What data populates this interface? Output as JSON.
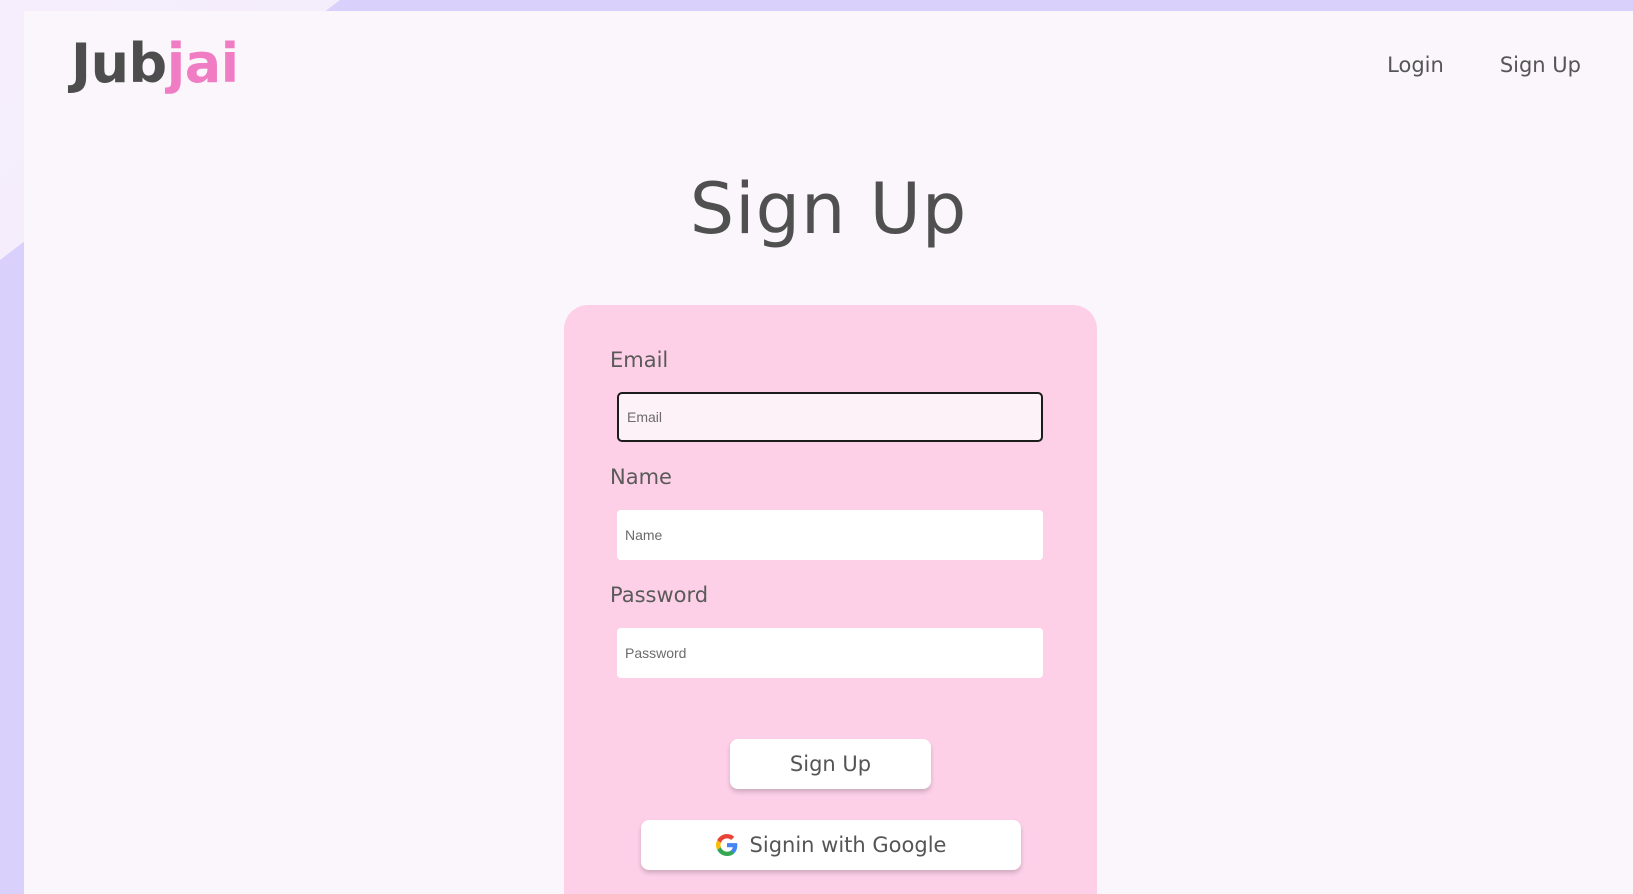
{
  "brand": {
    "logo_part1": "Jub",
    "logo_part2": "jai",
    "color_dark": "#4d4d4d",
    "color_pink": "#f07cc4"
  },
  "nav": {
    "login": "Login",
    "signup": "Sign Up"
  },
  "page_title": "Sign Up",
  "form": {
    "email_label": "Email",
    "email_placeholder": "Email",
    "email_value": "",
    "name_label": "Name",
    "name_placeholder": "Name",
    "name_value": "",
    "password_label": "Password",
    "password_placeholder": "Password",
    "password_value": "",
    "signup_button": "Sign Up",
    "google_button": "Signin with Google",
    "google_icon": "google-icon"
  },
  "colors": {
    "card_bg": "#fdd0e8",
    "page_bg": "#faf6fc",
    "outer_bg": "#d9d1fb"
  }
}
